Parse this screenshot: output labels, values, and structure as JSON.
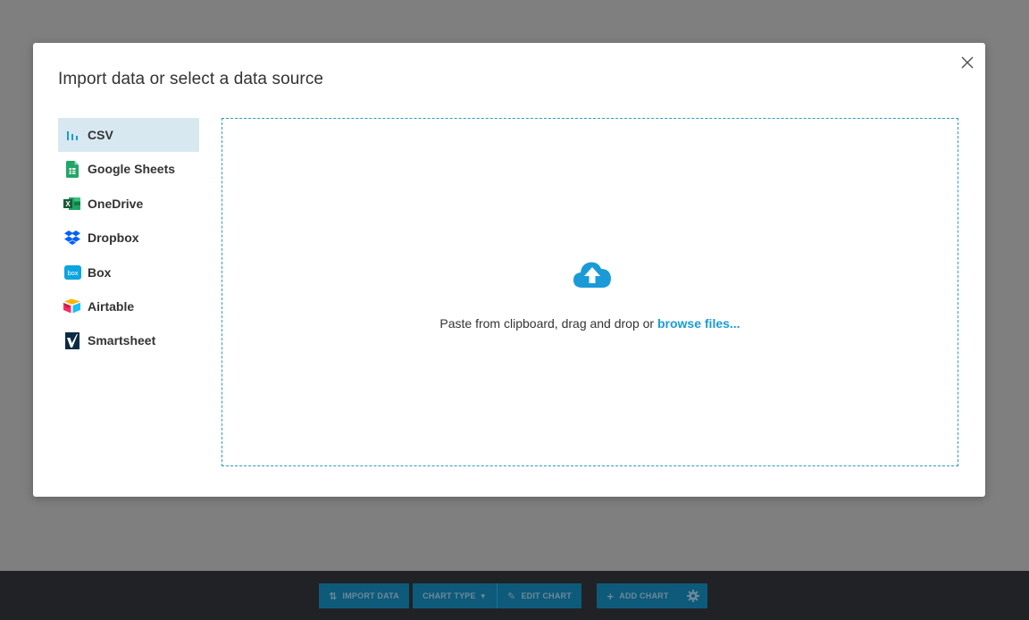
{
  "modal": {
    "title": "Import data or select a data source",
    "close_icon": "close-icon"
  },
  "sidebar": {
    "items": [
      {
        "label": "CSV",
        "icon": "bar-chart-icon",
        "active": true
      },
      {
        "label": "Google Sheets",
        "icon": "google-sheets-icon",
        "active": false
      },
      {
        "label": "OneDrive",
        "icon": "excel-icon",
        "active": false
      },
      {
        "label": "Dropbox",
        "icon": "dropbox-icon",
        "active": false
      },
      {
        "label": "Box",
        "icon": "box-icon",
        "active": false
      },
      {
        "label": "Airtable",
        "icon": "airtable-icon",
        "active": false
      },
      {
        "label": "Smartsheet",
        "icon": "smartsheet-icon",
        "active": false
      }
    ]
  },
  "dropzone": {
    "text": "Paste from clipboard, drag and drop or ",
    "link": "browse files..."
  },
  "toolbar": {
    "import_data": "IMPORT DATA",
    "chart_type": "CHART TYPE",
    "edit_chart": "EDIT CHART",
    "add_chart": "ADD CHART"
  },
  "colors": {
    "accent": "#1a9bd7",
    "active_bg": "#d8e8f1",
    "toolbar_button": "#0e5a7a",
    "overlay": "#7f7f7f"
  }
}
